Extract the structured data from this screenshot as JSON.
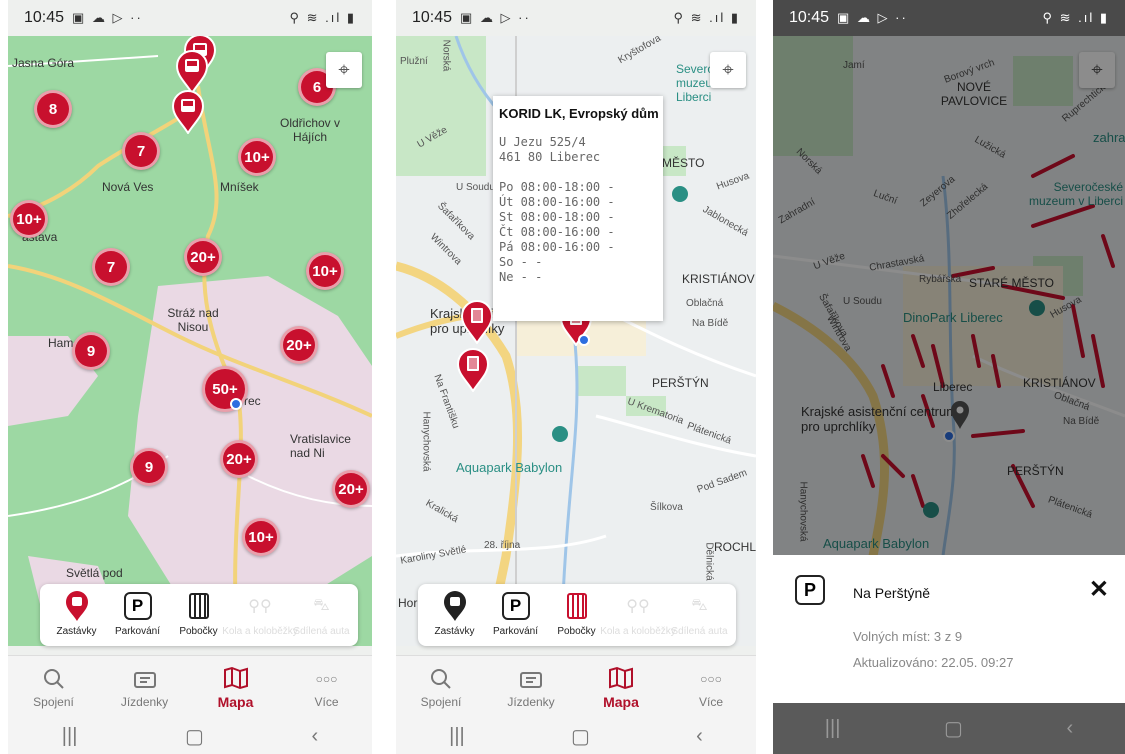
{
  "status": {
    "time": "10:45",
    "left_icons": "▣ ☁ ▷ ··",
    "right_icons": "⚲ ≋ .ıl ▮"
  },
  "colors": {
    "brand": "#c8102e",
    "active_nav": "#b0102a",
    "map_green": "#9dd8a3",
    "map_urban": "#ead9e4"
  },
  "screen1": {
    "map_labels": [
      "Jasna Góra",
      "Oldřichov v Hájích",
      "Nová Ves",
      "Mníšek",
      "astava",
      "Stráž nad Nisou",
      "Ham",
      "rec",
      "Vratislavice nad Ni",
      "Světlá pod"
    ],
    "clusters": [
      "8",
      "6",
      "7",
      "10+",
      "10+",
      "7",
      "20+",
      "10+",
      "9",
      "20+",
      "50+",
      "9",
      "20+",
      "20+",
      "10+"
    ]
  },
  "screen2": {
    "popup": {
      "title": "KORID LK, Evropský dům",
      "address1": "U Jezu 525/4",
      "address2": "461 80 Liberec",
      "hours": [
        "Po 08:00-18:00 -",
        "Út 08:00-16:00 -",
        "St 08:00-18:00 -",
        "Čt 08:00-16:00 -",
        "Pá 08:00-16:00 -",
        "So - -",
        "Ne - -"
      ]
    },
    "map_labels": [
      "Plužní",
      "Norská",
      "Kryštofova",
      "Severočeské muzeum v Liberci",
      "U Věže",
      "MĚSTO",
      "U Soudu",
      "Husova",
      "Šafaříkova",
      "Wintrova",
      "Jablonecká",
      "KRISTIÁNOV",
      "Oblačná",
      "Na Bídě",
      "Krajské asistenční centrum pro uprchlíky",
      "Na Františku",
      "PERŠTÝN",
      "U Krematoria",
      "Hanychovská",
      "Plátenická",
      "Aquapark Babylon",
      "Pod Sadem",
      "Kralická",
      "Šílkova",
      "Karoliny Světlé",
      "28. října",
      "ROCHL",
      "Dělnická",
      "Hor"
    ]
  },
  "screen3": {
    "map_labels": [
      "Jamí",
      "Borový vrch",
      "NOVÉ PAVLOVICE",
      "Ruprechtická",
      "zahra",
      "Norská",
      "Lužická",
      "Severočeské muzeum v Liberci",
      "Zahradní",
      "Luční",
      "Zeyerova",
      "Zhořelecká",
      "U Věže",
      "Chrastavská",
      "Rybářská",
      "STARÉ MĚSTO",
      "Šafaříkova",
      "Wintrova",
      "U Soudu",
      "DinoPark Liberec",
      "Husova",
      "Liberec",
      "KRISTIÁNOV",
      "Krajské asistenční centrum pro uprchlíky",
      "Oblačná",
      "Na Bídě",
      "PERŠTÝN",
      "Plátenická",
      "Aquapark Babylon",
      "Hanychovská"
    ],
    "sheet": {
      "title": "Na Perštýně",
      "close": "✕",
      "icon": "P",
      "free_spaces": "Volných míst: 3 z 9",
      "updated": "Aktualizováno: 22.05. 09:27"
    }
  },
  "filters": [
    {
      "label": "Zastávky",
      "icon": "bus-stop-pin-icon"
    },
    {
      "label": "Parkování",
      "icon": "parking-icon"
    },
    {
      "label": "Pobočky",
      "icon": "branch-office-icon"
    },
    {
      "label": "Kola a koloběžky",
      "icon": "bike-icon"
    },
    {
      "label": "Sdílená auta",
      "icon": "car-icon"
    }
  ],
  "nav": [
    {
      "label": "Spojení",
      "icon": "search-icon"
    },
    {
      "label": "Jízdenky",
      "icon": "ticket-icon"
    },
    {
      "label": "Mapa",
      "icon": "map-icon"
    },
    {
      "label": "Více",
      "icon": "more-dots-icon"
    }
  ],
  "sysnav": {
    "recents": "|||",
    "home": "▢",
    "back": "‹"
  }
}
